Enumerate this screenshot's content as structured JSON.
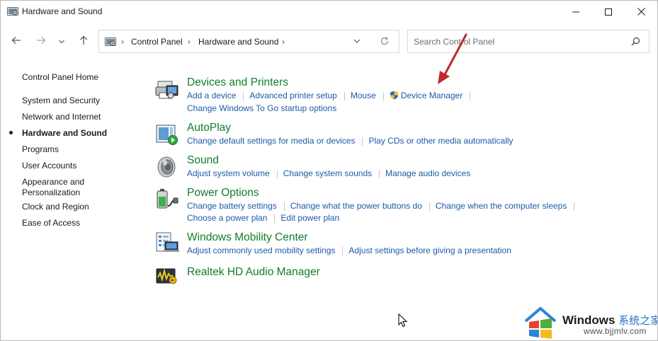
{
  "window": {
    "title": "Hardware and Sound",
    "controls": {
      "minimize": "minimize-icon",
      "maximize": "maximize-icon",
      "close": "close-icon"
    }
  },
  "navigation": {
    "back": "back-arrow-icon",
    "forward": "forward-arrow-icon",
    "recent": "chevron-down-icon",
    "up": "up-arrow-icon"
  },
  "address": {
    "crumbs": [
      "Control Panel",
      "Hardware and Sound"
    ],
    "separator": "›"
  },
  "search": {
    "placeholder": "Search Control Panel"
  },
  "sidebar": {
    "items": [
      {
        "label": "Control Panel Home"
      },
      {
        "label": "System and Security"
      },
      {
        "label": "Network and Internet"
      },
      {
        "label": "Hardware and Sound",
        "active": true
      },
      {
        "label": "Programs"
      },
      {
        "label": "User Accounts"
      },
      {
        "label": "Appearance and Personalization"
      },
      {
        "label": "Clock and Region"
      },
      {
        "label": "Ease of Access"
      }
    ]
  },
  "categories": [
    {
      "title": "Devices and Printers",
      "icon": "printer-icon",
      "links": [
        "Add a device",
        "Advanced printer setup",
        "Mouse",
        "Device Manager",
        "Change Windows To Go startup options"
      ]
    },
    {
      "title": "AutoPlay",
      "icon": "autoplay-icon",
      "links": [
        "Change default settings for media or devices",
        "Play CDs or other media automatically"
      ]
    },
    {
      "title": "Sound",
      "icon": "speaker-icon",
      "links": [
        "Adjust system volume",
        "Change system sounds",
        "Manage audio devices"
      ]
    },
    {
      "title": "Power Options",
      "icon": "battery-icon",
      "links": [
        "Change battery settings",
        "Change what the power buttons do",
        "Change when the computer sleeps",
        "Choose a power plan",
        "Edit power plan"
      ]
    },
    {
      "title": "Windows Mobility Center",
      "icon": "mobility-center-icon",
      "links": [
        "Adjust commonly used mobility settings",
        "Adjust settings before giving a presentation"
      ]
    },
    {
      "title": "Realtek HD Audio Manager",
      "icon": "realtek-audio-icon",
      "links": []
    }
  ],
  "colors": {
    "category_title": "#117d2b",
    "link": "#1c5aa6",
    "annotation_arrow": "#c0282f"
  },
  "watermark": {
    "brand": "Windows",
    "brand_cn": "系统之家",
    "url": "www.bjjmlv.com"
  }
}
